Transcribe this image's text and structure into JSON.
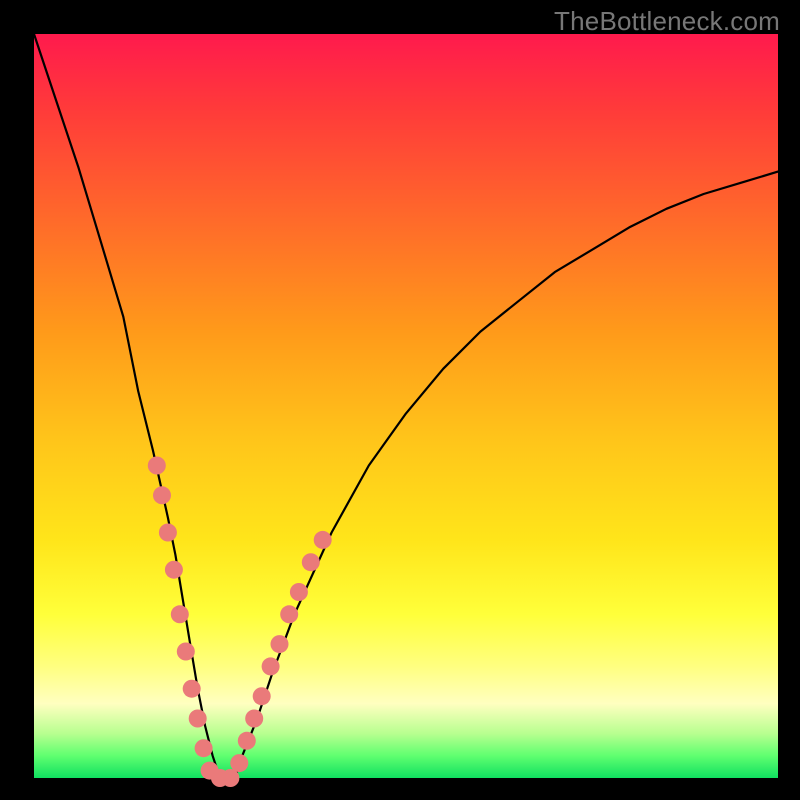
{
  "watermark": "TheBottleneck.com",
  "chart_data": {
    "type": "line",
    "title": "",
    "xlabel": "",
    "ylabel": "",
    "xlim": [
      0,
      100
    ],
    "ylim": [
      0,
      100
    ],
    "grid": false,
    "legend": false,
    "series": [
      {
        "name": "bottleneck-curve",
        "x": [
          0,
          3,
          6,
          9,
          12,
          14,
          16,
          18,
          19,
          20,
          21,
          22,
          23,
          24,
          25,
          26,
          27,
          28,
          30,
          32,
          35,
          40,
          45,
          50,
          55,
          60,
          65,
          70,
          75,
          80,
          85,
          90,
          95,
          100
        ],
        "y": [
          100,
          91,
          82,
          72,
          62,
          52,
          44,
          35,
          30,
          24,
          18,
          12,
          7,
          3,
          0,
          0,
          0,
          3,
          8,
          14,
          22,
          33,
          42,
          49,
          55,
          60,
          64,
          68,
          71,
          74,
          76.5,
          78.5,
          80,
          81.5
        ]
      }
    ],
    "markers": {
      "name": "highlight-dots",
      "color": "#ea7a7a",
      "points": [
        {
          "x": 16.5,
          "y": 42
        },
        {
          "x": 17.2,
          "y": 38
        },
        {
          "x": 18.0,
          "y": 33
        },
        {
          "x": 18.8,
          "y": 28
        },
        {
          "x": 19.6,
          "y": 22
        },
        {
          "x": 20.4,
          "y": 17
        },
        {
          "x": 21.2,
          "y": 12
        },
        {
          "x": 22.0,
          "y": 8
        },
        {
          "x": 22.8,
          "y": 4
        },
        {
          "x": 23.6,
          "y": 1
        },
        {
          "x": 25.0,
          "y": 0
        },
        {
          "x": 26.4,
          "y": 0
        },
        {
          "x": 27.6,
          "y": 2
        },
        {
          "x": 28.6,
          "y": 5
        },
        {
          "x": 29.6,
          "y": 8
        },
        {
          "x": 30.6,
          "y": 11
        },
        {
          "x": 31.8,
          "y": 15
        },
        {
          "x": 33.0,
          "y": 18
        },
        {
          "x": 34.3,
          "y": 22
        },
        {
          "x": 35.6,
          "y": 25
        },
        {
          "x": 37.2,
          "y": 29
        },
        {
          "x": 38.8,
          "y": 32
        }
      ]
    }
  }
}
